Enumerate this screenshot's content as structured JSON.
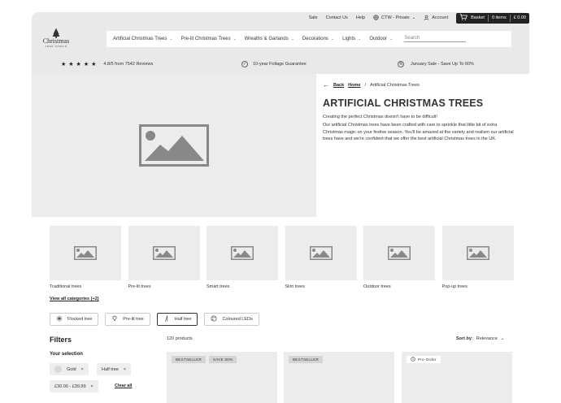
{
  "topbar": {
    "links": [
      "Sale",
      "Contact Us",
      "Help"
    ],
    "currency": "CTW - Private",
    "account": "Account",
    "basket_label": "Basket",
    "basket_items": "0 items",
    "basket_total": "£ 0.00"
  },
  "logo": {
    "brand": "Christmas",
    "sub": "TREE WORLD"
  },
  "nav": {
    "items": [
      "Artificial Christmas Trees",
      "Pre-lit Christmas Trees",
      "Wreaths & Garlands",
      "Decorations",
      "Lights",
      "Outdoor"
    ],
    "search_placeholder": "Search"
  },
  "usp": {
    "rating": "4.8/5 from 7542 Reviews",
    "guarantee": "10-year Foliage Guarantee",
    "sale": "January Sale - Save Up To 60%"
  },
  "breadcrumb": {
    "back": "Back",
    "home": "Home",
    "separator": "/",
    "current": "Artificial Christmas Trees"
  },
  "hero": {
    "title": "ARTIFICIAL CHRISTMAS TREES",
    "p1": "Creating the perfect Christmas doesn't have to be difficult!",
    "p2": "Our artificial Christmas trees have been crafted with care to sprinkle that little bit of extra Christmas magic on your festive season. You'll be amazed at the variety and realism our artificial trees have and we're confident that we offer the best artificial Christmas trees in the UK."
  },
  "categories": [
    "Traditional trees",
    "Pre-lit trees",
    "Smart trees",
    "Slim trees",
    "Outdoor trees",
    "Pop-up trees"
  ],
  "view_all": "View all categories (+2)",
  "quick_filters": [
    "Flocked tree",
    "Pre-lit tree",
    "Half tree",
    "Coloured LEDs"
  ],
  "filters": {
    "title": "Filters",
    "selection_title": "Your selection",
    "selected": [
      "Gold",
      "Half tree",
      "£30.00 - £39.99"
    ],
    "clear_all": "Clear all"
  },
  "results": {
    "count": "120 products",
    "sort_label": "Sort by:",
    "sort_value": "Relevance"
  },
  "products": [
    {
      "badges": [
        "BESTSELLER",
        "SAVE 60%"
      ]
    },
    {
      "badges": [
        "BESTSELLER"
      ]
    },
    {
      "badges": [
        "Pre-Order"
      ]
    }
  ]
}
